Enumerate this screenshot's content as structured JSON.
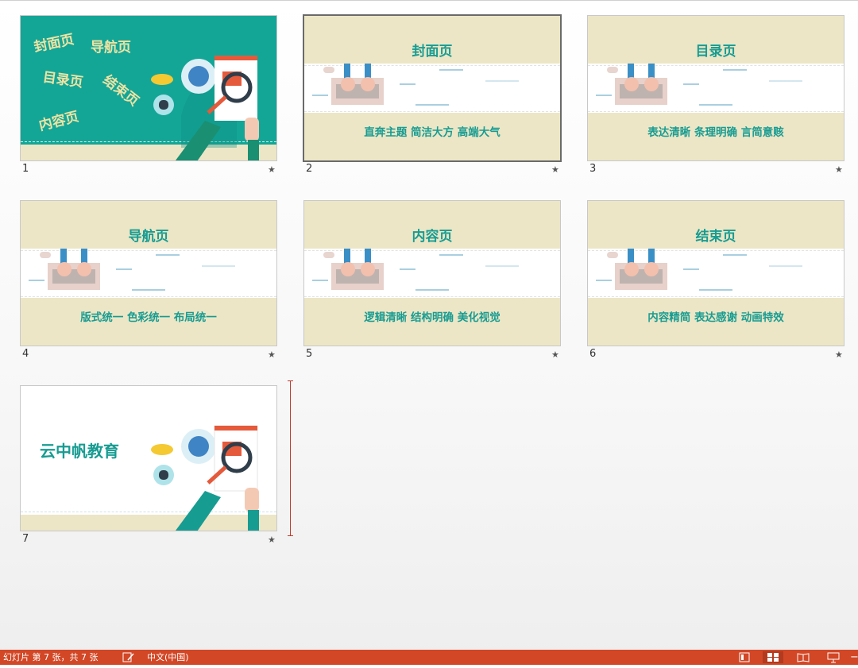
{
  "slides": [
    {
      "number": "1",
      "title": "",
      "subtitle": "",
      "cover_words": [
        "封面页",
        "导航页",
        "目录页",
        "结束页",
        "内容页"
      ]
    },
    {
      "number": "2",
      "title": "封面页",
      "subtitle": "直奔主题 简洁大方 高端大气"
    },
    {
      "number": "3",
      "title": "目录页",
      "subtitle": "表达清晰 条理明确 言简意赅"
    },
    {
      "number": "4",
      "title": "导航页",
      "subtitle": "版式统一 色彩统一 布局统一"
    },
    {
      "number": "5",
      "title": "内容页",
      "subtitle": "逻辑清晰 结构明确 美化视觉"
    },
    {
      "number": "6",
      "title": "结束页",
      "subtitle": "内容精简 表达感谢 动画特效"
    },
    {
      "number": "7",
      "title": "云中帆教育",
      "subtitle": ""
    }
  ],
  "slide_star": "★",
  "statusbar": {
    "slide_info": "幻灯片 第 7 张，共 7 张",
    "language": "中文(中国)",
    "notes_icon": "notes-edit-icon",
    "views": [
      "normal-view-icon",
      "slide-sorter-icon",
      "reading-view-icon",
      "slideshow-icon"
    ],
    "active_view": "slide-sorter-icon",
    "zoom_minus": "−"
  },
  "colors": {
    "accent": "#179c92",
    "band": "#ece6c6",
    "statusbar": "#d24726",
    "cover_bg": "#13a697"
  }
}
